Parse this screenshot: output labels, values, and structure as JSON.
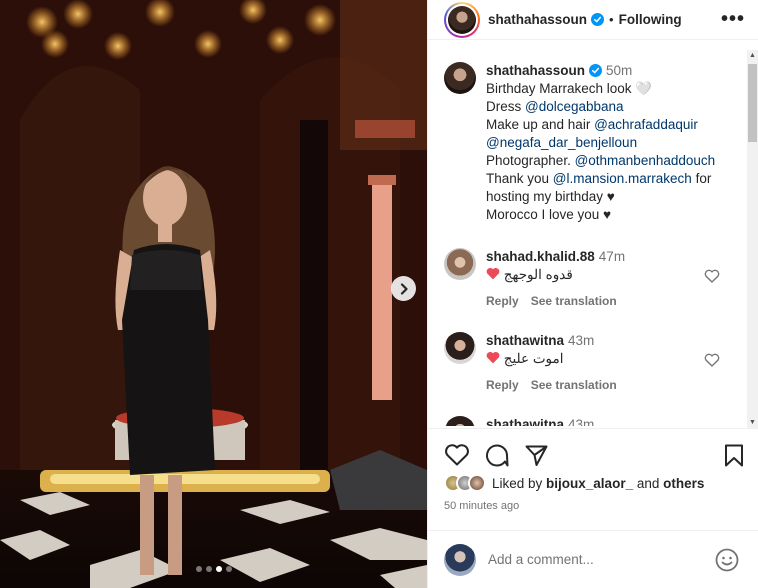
{
  "post": {
    "username": "shathahassoun",
    "follow_status": "Following",
    "separator": "•",
    "more_label": "•••",
    "carousel": {
      "slide_count": 4,
      "active_slide": 3
    }
  },
  "caption": {
    "username": "shathahassoun",
    "time": "50m",
    "lines": [
      {
        "text": "Birthday Marrakech look 🤍"
      },
      {
        "prefix": "Dress ",
        "link": "@dolcegabbana"
      },
      {
        "prefix": "Make up and hair ",
        "link": "@achrafaddaquir"
      },
      {
        "prefix": "",
        "link": "@negafa_dar_benjelloun"
      },
      {
        "prefix": "Photographer. ",
        "link": "@othmanbenhaddouch"
      },
      {
        "prefix": "Thank you ",
        "link": "@l.mansion.marrakech",
        "suffix": " for"
      },
      {
        "text": "hosting my birthday ♥"
      },
      {
        "text": "Morocco I love you ♥"
      }
    ]
  },
  "comments": [
    {
      "username": "shahad.khalid.88",
      "time": "47m",
      "text": "قدوه الوجهج",
      "reply": "Reply",
      "translate": "See translation"
    },
    {
      "username": "shathawitna",
      "time": "43m",
      "text": "اموت عليج",
      "reply": "Reply",
      "translate": "See translation"
    },
    {
      "username": "shathawitna",
      "time": "43m"
    }
  ],
  "likes": {
    "prefix": "Liked by ",
    "user": "bijoux_alaor_",
    "conj": " and ",
    "others": "others"
  },
  "timestamp": "50 minutes ago",
  "add_comment": {
    "placeholder": "Add a comment..."
  },
  "colors": {
    "link": "#00376b",
    "verified": "#0095f6",
    "heart": "#ed4956",
    "muted": "#737373"
  }
}
